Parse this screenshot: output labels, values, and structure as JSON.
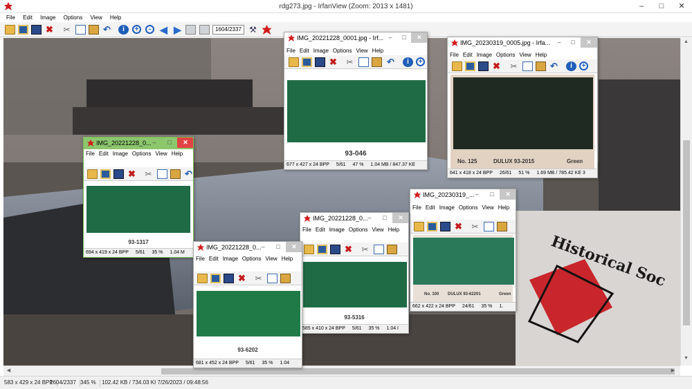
{
  "window": {
    "title": "rdg273.jpg - IrfanView (Zoom: 2013 x 1481)"
  },
  "menu": [
    "File",
    "Edit",
    "Image",
    "Options",
    "View",
    "Help"
  ],
  "toolbar": {
    "page_counter": "1604/2337"
  },
  "status": {
    "dims": "583 x 429 x 24 BPP",
    "index": "1604/2337",
    "zoom": "345 %",
    "size": "102.42 KB / 734.03 KI 7/26/2023 / 09:48:56"
  },
  "colors": {
    "green_swatch": "#1f6b45",
    "dark_swatch": "#1f2a22",
    "active_title": "#8cc66d"
  },
  "windows": [
    {
      "title": "IMG_20221228_0...",
      "menu": [
        "File",
        "Edit",
        "Image",
        "Options",
        "View",
        "Help"
      ],
      "label": "93-1317",
      "status": [
        "694 x 419 x 24 BPP",
        "5/61",
        "35 %",
        "1.04 M"
      ]
    },
    {
      "title": "IMG_20221228_0001.jpg - Irf...",
      "menu": [
        "File",
        "Edit",
        "Image",
        "Options",
        "View",
        "Help"
      ],
      "label": "93-046",
      "status": [
        "677 x 427 x 24 BPP",
        "5/61",
        "47 %",
        "1.04 MB / 847.37 KE"
      ]
    },
    {
      "title": "IMG_20230319_0005.jpg - Irfa...",
      "menu": [
        "File",
        "Edit",
        "Image",
        "Options",
        "View",
        "Help"
      ],
      "label_left": "No. 125",
      "label_mid": "DULUX 93-2015",
      "label_right": "Green",
      "status": [
        "641 x 418 x 24 BPP",
        "26/61",
        "51 %",
        "1.69 MB / 785.42 KE 3"
      ]
    },
    {
      "title": "IMG_20230319_...",
      "menu": [
        "File",
        "Edit",
        "Image",
        "Options",
        "View",
        "Help"
      ],
      "label_left": "No. 100",
      "label_mid": "DULUX 93-62201",
      "label_right": "Green",
      "status": [
        "662 x 422 x 24 BPP",
        "24/61",
        "35 %",
        "1."
      ]
    },
    {
      "title": "IMG_20221228_0...",
      "menu": [
        "File",
        "Edit",
        "Image",
        "Options",
        "View",
        "Help"
      ],
      "label": "93-5316",
      "status": [
        "585 x 410 x 24 BPP",
        "5/61",
        "35 %",
        "1.04 I"
      ]
    },
    {
      "title": "IMG_20221228_0...",
      "menu": [
        "File",
        "Edit",
        "Image",
        "Options",
        "View",
        "Help"
      ],
      "label": "93-6202",
      "status": [
        "681 x 452 x 24 BPP",
        "5/61",
        "35 %",
        "1.04"
      ]
    }
  ]
}
